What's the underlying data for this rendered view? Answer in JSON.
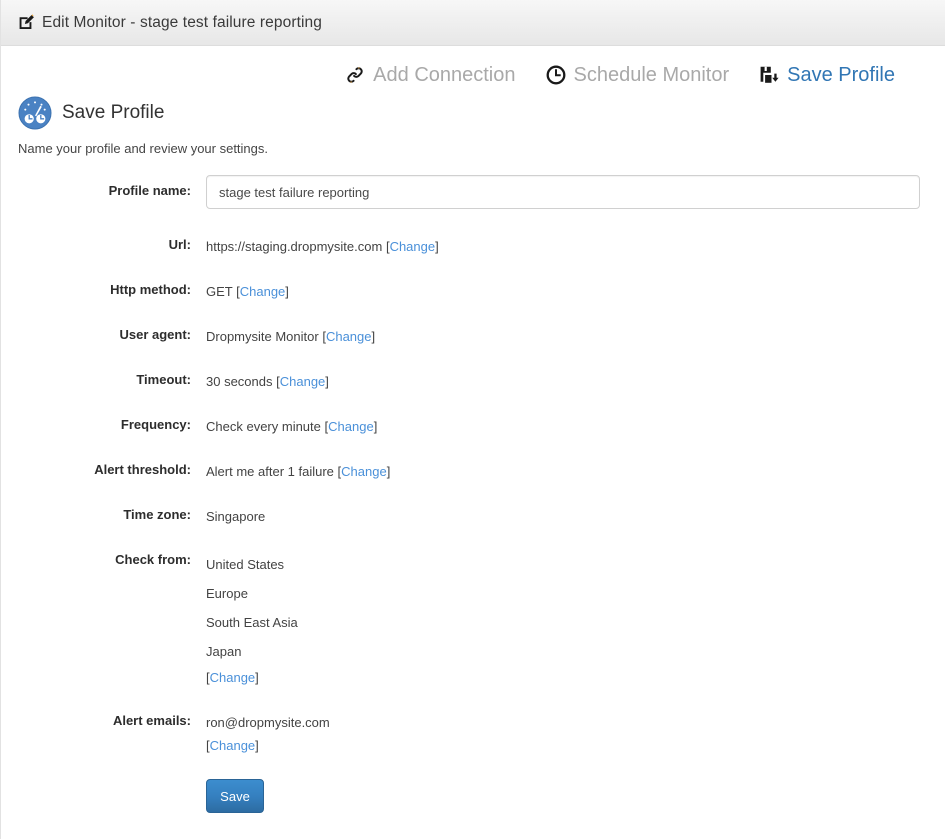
{
  "window": {
    "title": "Edit Monitor - stage test failure reporting",
    "title_icon": "edit-square-icon"
  },
  "toolbar": {
    "items": [
      {
        "label": "Add Connection",
        "icon": "link-icon",
        "state": "disabled"
      },
      {
        "label": "Schedule Monitor",
        "icon": "clock-icon",
        "state": "disabled"
      },
      {
        "label": "Save Profile",
        "icon": "save-icon",
        "state": "active"
      }
    ]
  },
  "section": {
    "icon": "gauge-icon",
    "title": "Save Profile",
    "subtitle": "Name your profile and review your settings."
  },
  "form": {
    "profile_name": {
      "label": "Profile name:",
      "value": "stage test failure reporting",
      "placeholder": "Profile name"
    },
    "url": {
      "label": "Url:",
      "value": "https://staging.dropmysite.com",
      "change": "Change"
    },
    "http_method": {
      "label": "Http method:",
      "value": "GET",
      "change": "Change"
    },
    "user_agent": {
      "label": "User agent:",
      "value": "Dropmysite Monitor",
      "change": "Change"
    },
    "timeout": {
      "label": "Timeout:",
      "value": "30 seconds",
      "change": "Change"
    },
    "frequency": {
      "label": "Frequency:",
      "value": "Check every minute",
      "change": "Change"
    },
    "alert_threshold": {
      "label": "Alert threshold:",
      "value": "Alert me after 1 failure",
      "change": "Change"
    },
    "time_zone": {
      "label": "Time zone:",
      "value": "Singapore"
    },
    "check_from": {
      "label": "Check from:",
      "locations": [
        "United States",
        "Europe",
        "South East Asia",
        "Japan"
      ],
      "change": "Change"
    },
    "alert_emails": {
      "label": "Alert emails:",
      "emails": [
        "ron@dropmysite.com"
      ],
      "change": "Change"
    },
    "save_button": "Save"
  },
  "colors": {
    "link_blue": "#4a90d9",
    "active_blue": "#3176b4",
    "button_blue": "#3580c0",
    "header_bg": "#eeeeee",
    "text": "#434343"
  }
}
